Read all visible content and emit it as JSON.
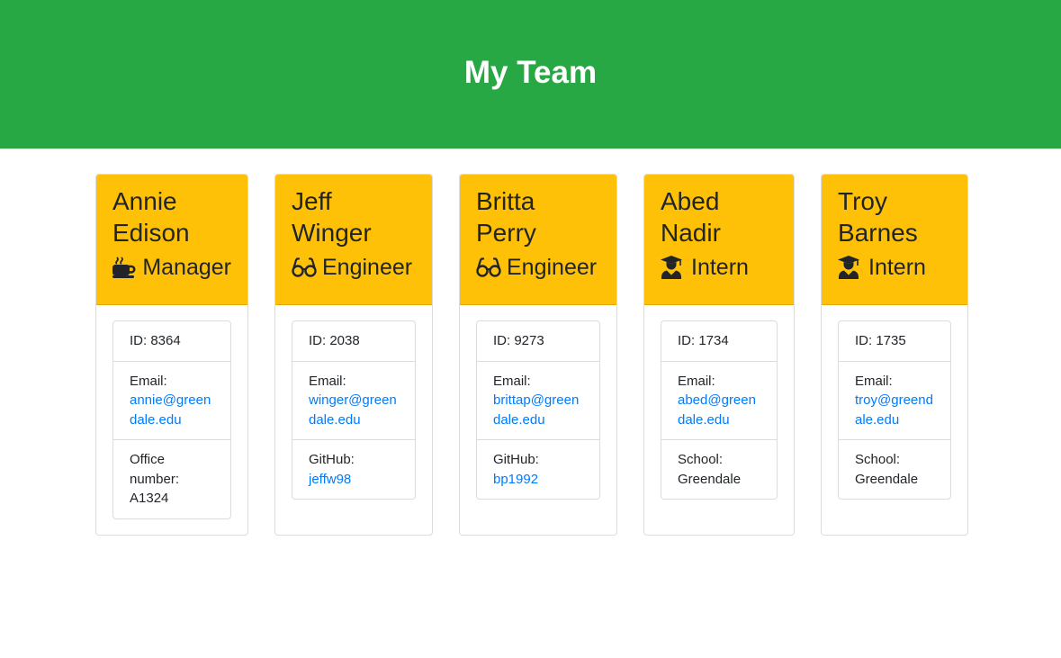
{
  "header": {
    "title": "My Team"
  },
  "colors": {
    "header_bg": "#28a745",
    "card_header_bg": "#ffc107",
    "link": "#007bff"
  },
  "employees": [
    {
      "first": "Annie",
      "last": "Edison",
      "role": "Manager",
      "icon": "coffee-icon",
      "id_text": "ID: 8364",
      "email_label": "Email:",
      "email": "annie@greendale.edu",
      "extra_label": "Office number:",
      "extra_value": "A1324"
    },
    {
      "first": "Jeff",
      "last": "Winger",
      "role": "Engineer",
      "icon": "glasses-icon",
      "id_text": "ID: 2038",
      "email_label": "Email:",
      "email": "winger@greendale.edu",
      "extra_label": "GitHub:",
      "extra_value": "jeffw98"
    },
    {
      "first": "Britta",
      "last": "Perry",
      "role": "Engineer",
      "icon": "glasses-icon",
      "id_text": "ID: 9273",
      "email_label": "Email:",
      "email": "brittap@greendale.edu",
      "extra_label": "GitHub:",
      "extra_value": "bp1992"
    },
    {
      "first": "Abed",
      "last": "Nadir",
      "role": "Intern",
      "icon": "graduate-icon",
      "id_text": "ID: 1734",
      "email_label": "Email:",
      "email": "abed@greendale.edu",
      "extra_label": "School:",
      "extra_value": "Greendale"
    },
    {
      "first": "Troy",
      "last": "Barnes",
      "role": "Intern",
      "icon": "graduate-icon",
      "id_text": "ID: 1735",
      "email_label": "Email:",
      "email": "troy@greendale.edu",
      "extra_label": "School:",
      "extra_value": "Greendale"
    }
  ]
}
